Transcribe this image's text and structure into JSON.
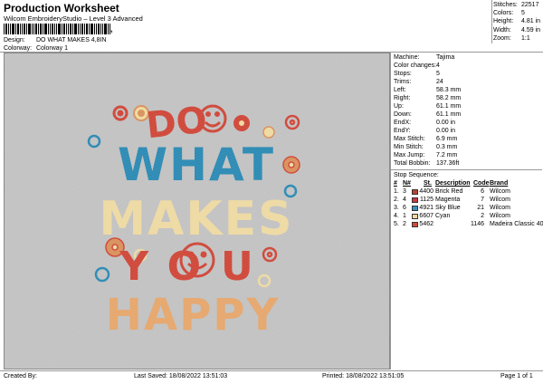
{
  "header": {
    "title": "Production Worksheet",
    "subtitle": "Wilcom EmbroideryStudio – Level 3 Advanced",
    "barcode_suffix": ","
  },
  "meta": {
    "design_label": "Design:",
    "design_value": "DO WHAT MAKES 4,8IN",
    "colorway_label": "Colorway:",
    "colorway_value": "Colorway 1"
  },
  "stats": [
    {
      "label": "Stitches:",
      "value": "22517"
    },
    {
      "label": "Colors:",
      "value": "5"
    },
    {
      "label": "Height:",
      "value": "4.81 in"
    },
    {
      "label": "Width:",
      "value": "4.59 in"
    },
    {
      "label": "Zoom:",
      "value": "1:1"
    }
  ],
  "properties": [
    {
      "label": "Machine:",
      "value": "Tajima"
    },
    {
      "label": "Color changes:",
      "value": "4"
    },
    {
      "label": "Stops:",
      "value": "5"
    },
    {
      "label": "Trims:",
      "value": "24"
    },
    {
      "label": "Left:",
      "value": "58.3 mm"
    },
    {
      "label": "Right:",
      "value": "58.2 mm"
    },
    {
      "label": "Up:",
      "value": "61.1 mm"
    },
    {
      "label": "Down:",
      "value": "61.1 mm"
    },
    {
      "label": "EndX:",
      "value": "0.00 in"
    },
    {
      "label": "EndY:",
      "value": "0.00 in"
    },
    {
      "label": "Max Stitch:",
      "value": "6.9 mm"
    },
    {
      "label": "Min Stitch:",
      "value": "0.3 mm"
    },
    {
      "label": "Max Jump:",
      "value": "7.2 mm"
    },
    {
      "label": "Total Bobbin:",
      "value": "137.36ft"
    }
  ],
  "sequence": {
    "title": "Stop Sequence:",
    "headers": {
      "num": "#",
      "n": "N#",
      "st": "St.",
      "description": "Description",
      "code": "Code",
      "brand": "Brand"
    },
    "rows": [
      {
        "num": "1.",
        "n": "3",
        "color": "#b5452f",
        "st": "4400",
        "description": "Brick Red",
        "code": "6",
        "brand": "Wilcom"
      },
      {
        "num": "2.",
        "n": "4",
        "color": "#c8354a",
        "st": "1125",
        "description": "Magenta",
        "code": "7",
        "brand": "Wilcom"
      },
      {
        "num": "3.",
        "n": "6",
        "color": "#3a8fc2",
        "st": "4921",
        "description": "Sky Blue",
        "code": "21",
        "brand": "Wilcom"
      },
      {
        "num": "4.",
        "n": "1",
        "color": "#f2d9a0",
        "st": "6607",
        "description": "Cyan",
        "code": "2",
        "brand": "Wilcom"
      },
      {
        "num": "5.",
        "n": "2",
        "color": "#d24a3a",
        "st": "5462",
        "description": "",
        "code": "1146",
        "brand": "Madeira Classic 40"
      }
    ]
  },
  "artwork": {
    "lines": [
      "DO",
      "WHAT",
      "MAKES",
      "YOU",
      "HAPPY"
    ],
    "colors": {
      "red": "#d04a3c",
      "blue": "#2f8cb5",
      "cream": "#eedaa4",
      "orange": "#d9935f",
      "peach": "#e6a86f"
    }
  },
  "footer": {
    "created_by": "Created By:",
    "last_saved": "Last Saved: 18/08/2022 13:51:03",
    "printed": "Printed: 18/08/2022 13:51:05",
    "page": "Page 1 of 1"
  }
}
